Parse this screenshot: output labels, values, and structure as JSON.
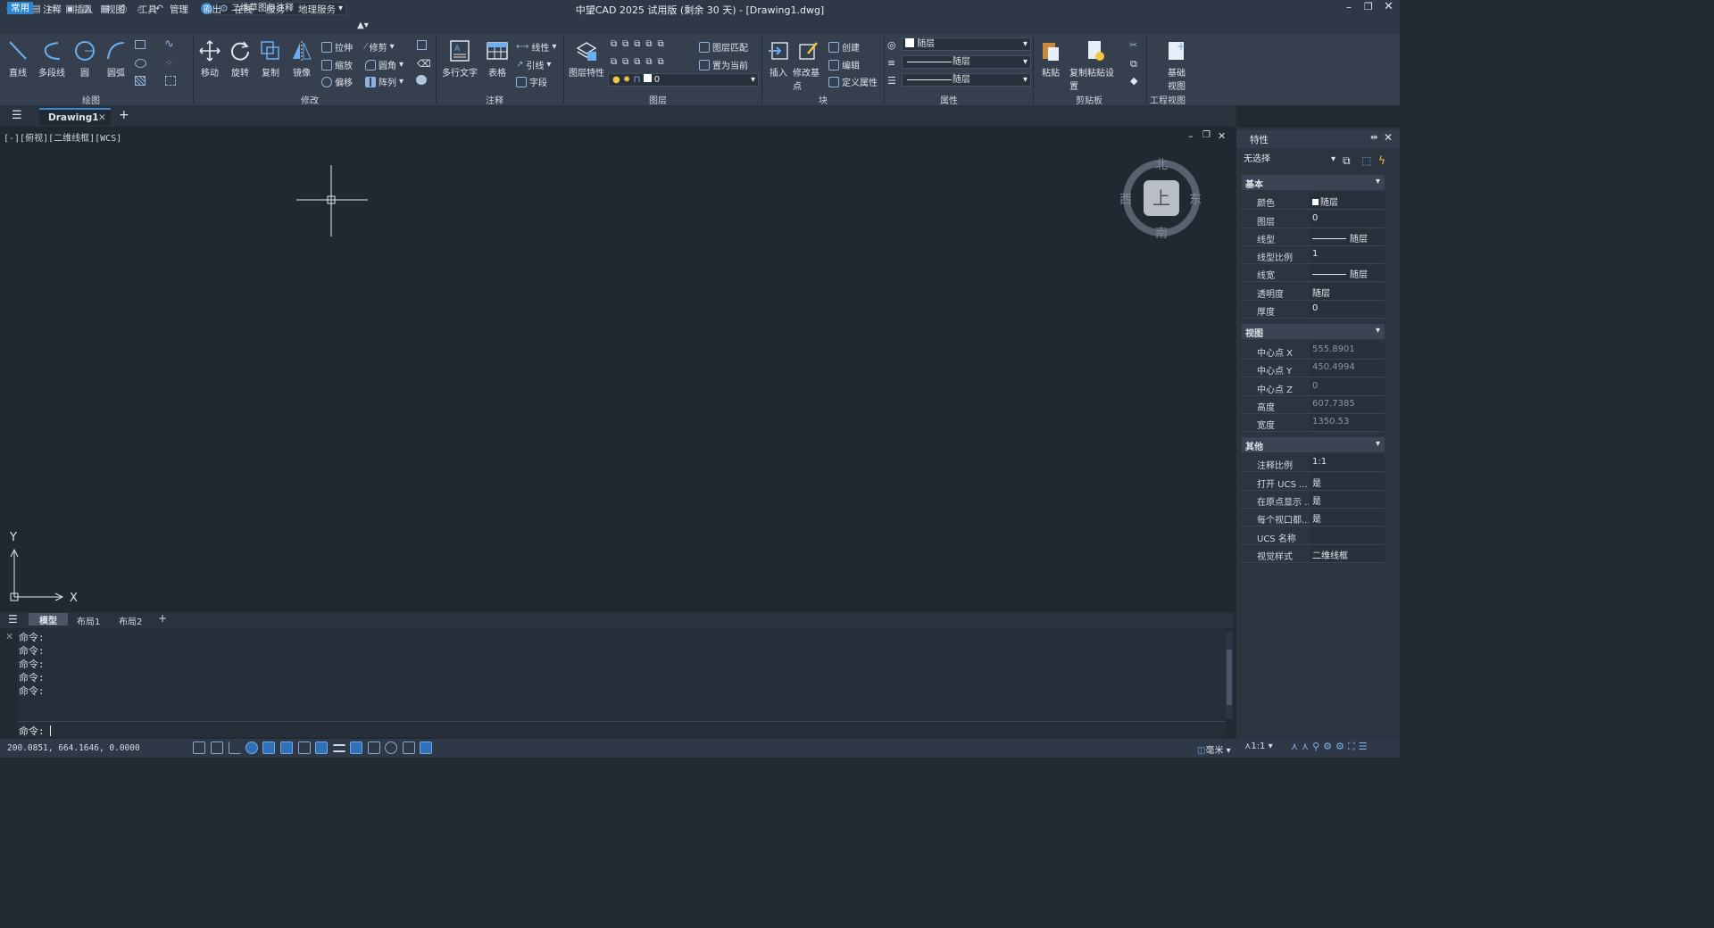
{
  "window": {
    "title": "中望CAD 2025 试用版 (剩余 30 天) - [Drawing1.dwg]"
  },
  "quick_access": {
    "workspace": "二维草图与注释"
  },
  "menu": [
    "常用",
    "注释",
    "插入",
    "视图",
    "工具",
    "管理",
    "输出",
    "在线",
    "服务",
    "地理服务"
  ],
  "ribbon": {
    "draw": {
      "label": "绘图",
      "line": "直线",
      "polyline": "多段线",
      "circle": "圆",
      "arc": "圆弧"
    },
    "modify": {
      "label": "修改",
      "move": "移动",
      "rotate": "旋转",
      "copy": "复制",
      "mirror": "镜像",
      "stretch": "拉伸",
      "scale": "缩放",
      "offset": "偏移",
      "trim": "修剪",
      "fillet": "圆角",
      "array": "阵列"
    },
    "annotation": {
      "label": "注释",
      "mtext": "多行文字",
      "table": "表格",
      "linear": "线性",
      "leader": "引线",
      "field": "字段"
    },
    "layers": {
      "label": "图层",
      "props": "图层特性",
      "match": "图层匹配",
      "set_current": "置为当前",
      "current_layer": "0"
    },
    "block": {
      "label": "块",
      "insert": "插入",
      "edit_base": "修改基点",
      "create": "创建",
      "edit": "编辑",
      "define_attr": "定义属性"
    },
    "properties": {
      "label": "属性",
      "color": "随层",
      "linetype": "随层",
      "lineweight": "随层"
    },
    "clipboard": {
      "label": "剪贴板",
      "paste": "粘贴",
      "copy_paste_settings": "复制粘贴设置"
    },
    "engview": {
      "label": "工程视图",
      "base_view": "基础视图"
    }
  },
  "doc_tab": "Drawing1",
  "view_label": "[-][俯视][二维线框][WCS]",
  "viewcube": {
    "n": "北",
    "s": "南",
    "e": "东",
    "w": "西",
    "top": "上"
  },
  "ucs": {
    "x": "X",
    "y": "Y"
  },
  "layout_tabs": [
    "模型",
    "布局1",
    "布局2"
  ],
  "command": {
    "history": [
      "命令:",
      "命令:",
      "命令:",
      "命令:",
      "命令:"
    ],
    "prompt": "命令:"
  },
  "status": {
    "coords": "200.0851, 664.1646, 0.0000",
    "units": "毫米",
    "scale": "1:1"
  },
  "properties_panel": {
    "title": "特性",
    "selection": "无选择",
    "basic": {
      "label": "基本",
      "rows": [
        [
          "颜色",
          "随层"
        ],
        [
          "图层",
          "0"
        ],
        [
          "线型",
          "随层"
        ],
        [
          "线型比例",
          "1"
        ],
        [
          "线宽",
          "随层"
        ],
        [
          "透明度",
          "随层"
        ],
        [
          "厚度",
          "0"
        ]
      ]
    },
    "view": {
      "label": "视图",
      "rows": [
        [
          "中心点 X",
          "555.8901"
        ],
        [
          "中心点 Y",
          "450.4994"
        ],
        [
          "中心点 Z",
          "0"
        ],
        [
          "高度",
          "607.7385"
        ],
        [
          "宽度",
          "1350.53"
        ]
      ]
    },
    "other": {
      "label": "其他",
      "rows": [
        [
          "注释比例",
          "1:1"
        ],
        [
          "打开 UCS ...",
          "是"
        ],
        [
          "在原点显示 ...",
          "是"
        ],
        [
          "每个视口都...",
          "是"
        ],
        [
          "UCS 名称",
          ""
        ],
        [
          "视觉样式",
          "二维线框"
        ]
      ]
    }
  }
}
